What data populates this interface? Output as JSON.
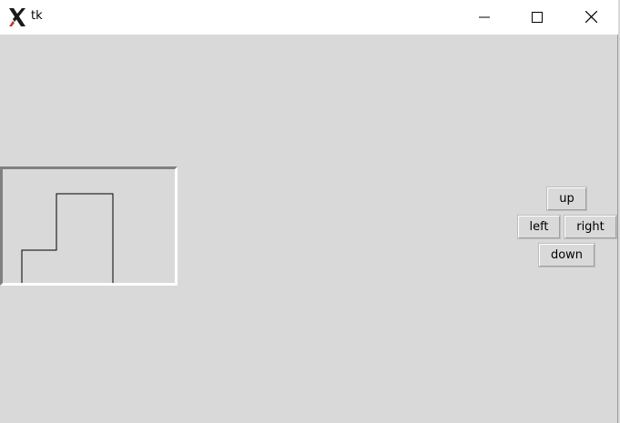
{
  "window": {
    "title": "tk",
    "controls": {
      "minimize": "minimize-icon",
      "maximize": "maximize-icon",
      "close": "close-icon"
    }
  },
  "buttons": {
    "up": "up",
    "left": "left",
    "right": "right",
    "down": "down"
  },
  "colors": {
    "background": "#d9d9d9",
    "titlebar": "#ffffff",
    "line": "#000000"
  }
}
